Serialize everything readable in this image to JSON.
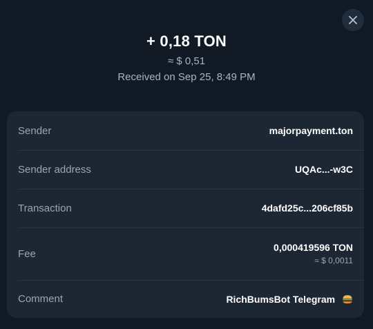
{
  "header": {
    "amount": "+ 0,18 TON",
    "fiat": "≈ $ 0,51",
    "received": "Received on Sep 25, 8:49 PM"
  },
  "details": {
    "sender": {
      "label": "Sender",
      "value": "majorpayment.ton"
    },
    "sender_address": {
      "label": "Sender address",
      "value": "UQAc...-w3C"
    },
    "transaction": {
      "label": "Transaction",
      "value": "4dafd25c...206cf85b"
    },
    "fee": {
      "label": "Fee",
      "value": "0,000419596 TON",
      "fiat": "≈ $ 0,0011"
    },
    "comment": {
      "label": "Comment",
      "value": "RichBumsBot Telegram",
      "icon": "burger-emoji-icon"
    }
  },
  "controls": {
    "close_icon": "close-icon"
  },
  "colors": {
    "background": "#111a24",
    "card": "#1c2733",
    "muted_text": "#9aa6b4"
  }
}
